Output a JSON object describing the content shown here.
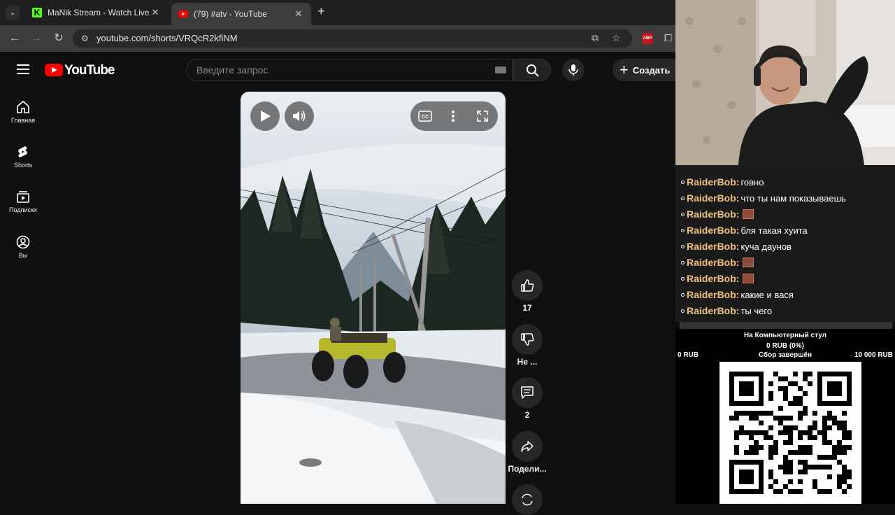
{
  "browser": {
    "tabs": [
      {
        "title": "MaNik Stream - Watch Live on",
        "favicon": "kick-favicon",
        "active": false
      },
      {
        "title": "(79) #atv - YouTube",
        "favicon": "youtube-favicon",
        "active": true
      }
    ],
    "url": "youtube.com/shorts/VRQcR2kfiNM"
  },
  "youtube": {
    "logo_text": "YouTube",
    "search_placeholder": "Введите запрос",
    "create_label": "Создать",
    "sidebar": [
      {
        "label": "Главная",
        "icon": "home-icon"
      },
      {
        "label": "Shorts",
        "icon": "shorts-icon"
      },
      {
        "label": "Подписки",
        "icon": "subscriptions-icon"
      },
      {
        "label": "Вы",
        "icon": "you-icon"
      }
    ],
    "actions": {
      "like_count": "17",
      "dislike_label": "Не ...",
      "comments_count": "2",
      "share_label": "Подели..."
    }
  },
  "chat": {
    "messages": [
      {
        "nick": "RaiderBob:",
        "text": "говно",
        "emote": false
      },
      {
        "nick": "RaiderBob:",
        "text": "что ты нам показываешь",
        "emote": false
      },
      {
        "nick": "RaiderBob:",
        "text": "",
        "emote": true
      },
      {
        "nick": "RaiderBob:",
        "text": "бля такая хуита",
        "emote": false
      },
      {
        "nick": "RaiderBob:",
        "text": "куча даунов",
        "emote": false
      },
      {
        "nick": "RaiderBob:",
        "text": "",
        "emote": true
      },
      {
        "nick": "RaiderBob:",
        "text": "",
        "emote": true
      },
      {
        "nick": "RaiderBob:",
        "text": "какие и вася",
        "emote": false
      },
      {
        "nick": "RaiderBob:",
        "text": "ты чего",
        "emote": false
      }
    ]
  },
  "donation": {
    "goal_title": "На Компьютерный стул",
    "raised": "0 RUB (0%)",
    "min": "0 RUB",
    "status": "Сбор завершён",
    "max": "10 000 RUB",
    "progress": 0
  },
  "colors": {
    "youtube_red": "#ff0000",
    "chat_nick": "#f0c27b",
    "page_bg": "#0f0f0f"
  }
}
